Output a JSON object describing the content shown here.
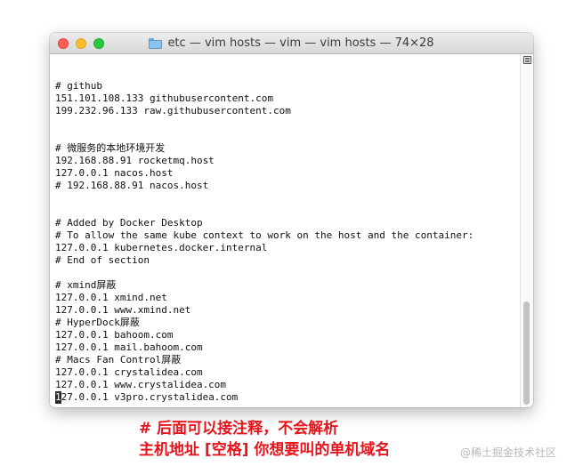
{
  "window": {
    "title": "etc — vim hosts — vim — vim hosts — 74×28"
  },
  "editor": {
    "lines": [
      "",
      "# github",
      "151.101.108.133 githubusercontent.com",
      "199.232.96.133 raw.githubusercontent.com",
      "",
      "",
      "# 微服务的本地环境开发",
      "192.168.88.91 rocketmq.host",
      "127.0.0.1 nacos.host",
      "# 192.168.88.91 nacos.host",
      "",
      "",
      "# Added by Docker Desktop",
      "# To allow the same kube context to work on the host and the container:",
      "127.0.0.1 kubernetes.docker.internal",
      "# End of section",
      "",
      "# xmind屏蔽",
      "127.0.0.1 xmind.net",
      "127.0.0.1 www.xmind.net",
      "# HyperDock屏蔽",
      "127.0.0.1 bahoom.com",
      "127.0.0.1 mail.bahoom.com",
      "# Macs Fan Control屏蔽",
      "127.0.0.1 crystalidea.com",
      "127.0.0.1 www.crystalidea.com"
    ],
    "cursor_line": {
      "cursor_char": "1",
      "rest": "27.0.0.1 v3pro.crystalidea.com"
    }
  },
  "annotation": {
    "line1": "# 后面可以接注释，不会解析",
    "line2": "主机地址 [空格] 你想要叫的单机域名"
  },
  "watermark": "@稀土掘金技术社区",
  "icons": {
    "folder": "folder-icon",
    "scroll_menu": "scrollbar-menu-icon"
  },
  "colors": {
    "close": "#fd5f57",
    "minimize": "#febc2e",
    "zoom": "#28c840",
    "annotation": "#e8141b"
  }
}
